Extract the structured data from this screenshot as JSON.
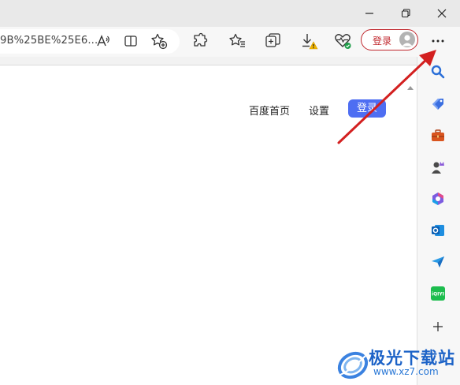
{
  "browser": {
    "address_bar": {
      "url_text": "9B%25BE%25E6..."
    },
    "toolbar": {
      "login_label": "登录",
      "icons": [
        "read-aloud-icon",
        "split-screen-icon",
        "add-favorite-icon",
        "extensions-icon",
        "favorites-icon",
        "collections-icon",
        "downloads-icon",
        "browser-essentials-icon",
        "more-icon"
      ]
    },
    "window_controls": [
      "minimize-icon",
      "restore-icon",
      "close-icon"
    ],
    "sidebar": {
      "items": [
        "search-icon",
        "shopping-tag-icon",
        "tools-briefcase-icon",
        "games-icon",
        "office-icon",
        "outlook-icon",
        "send-icon",
        "iqiyi-icon",
        "add-icon"
      ],
      "iqiyi_label": "iQIYI"
    }
  },
  "page": {
    "nav": {
      "home_link": "百度首页",
      "settings_link": "设置",
      "login_button": "登录"
    }
  },
  "watermark": {
    "title": "极光下载站",
    "url": "www.xz7.com"
  },
  "colors": {
    "login_red": "#c0272d",
    "baidu_blue": "#4e6ef2",
    "arrow_red": "#d32020"
  }
}
